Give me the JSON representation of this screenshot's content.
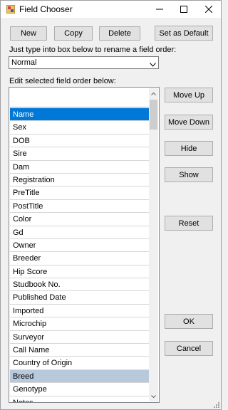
{
  "window": {
    "title": "Field Chooser"
  },
  "toolbar": {
    "new_label": "New",
    "copy_label": "Copy",
    "delete_label": "Delete",
    "set_default_label": "Set as Default"
  },
  "rename": {
    "label": "Just type into box below to rename a field order:",
    "value": "Normal"
  },
  "edit": {
    "label": "Edit selected field order below:"
  },
  "fields": [
    "Name",
    "Sex",
    "DOB",
    "Sire",
    "Dam",
    "Registration",
    "PreTitle",
    "PostTitle",
    "Color",
    "Gd",
    "Owner",
    "Breeder",
    "Hip Score",
    "Studbook No.",
    "Published Date",
    "Imported",
    "Microchip",
    "Surveyor",
    "Call Name",
    "Country of Origin",
    "Breed",
    "Genotype",
    "Notes"
  ],
  "selected_field": "Name",
  "highlighted_field": "Breed",
  "actions": {
    "move_up": "Move Up",
    "move_down": "Move Down",
    "hide": "Hide",
    "show": "Show",
    "reset": "Reset",
    "ok": "OK",
    "cancel": "Cancel"
  },
  "colors": {
    "selection": "#0078d7",
    "highlight": "#b8c9dc"
  }
}
